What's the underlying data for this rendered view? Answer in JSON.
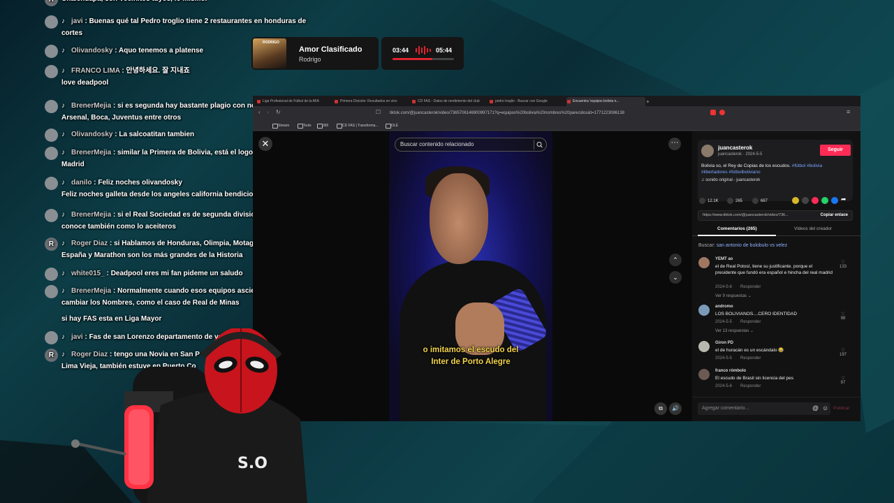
{
  "chat": [
    {
      "user": "",
      "text": "Chalchuapa, son Vecinitos tuyos, lo mismo.",
      "cont": "",
      "avatar": "R",
      "partial": true
    },
    {
      "user": "javi",
      "text": "Buenas qué tal Pedro troglio tiene 2 restaurantes en honduras de",
      "cont": "cortes"
    },
    {
      "user": "Olivandosky",
      "text": "Aquo tenemos a platense",
      "cont": ""
    },
    {
      "user": "FRANCO LIMA",
      "text": "안녕하세요. 잘 지내죠",
      "cont": "love deadpool"
    },
    {
      "user": "BrenerMejia",
      "text": "si es segunda hay bastante plagio con nombre está",
      "cont": "Arsenal, Boca, Juventus entre otros"
    },
    {
      "user": "Olivandosky",
      "text": "La salcoatitan tambien",
      "cont": ""
    },
    {
      "user": "BrenerMejia",
      "text": "similar la Primera de Bolivia, está el logo de River, Real",
      "cont": "Madrid"
    },
    {
      "user": "danilo",
      "text": "Feliz noches olivandosky",
      "cont": "Feliz noches galleta desde los angeles california bendiciones"
    },
    {
      "user": "BrenerMejia",
      "text": "si el Real Sociedad es de segunda división también, se le",
      "cont": "conoce también como lo aceiteros"
    },
    {
      "user": "Roger Diaz",
      "text": "si Hablamos de Honduras, Olimpia, Motagua, Real",
      "cont": "España y Marathon son los más grandes de la Historia",
      "avatar": "R"
    },
    {
      "user": "white015_",
      "text": "Deadpool eres mi fan pideme un saludo",
      "cont": ""
    },
    {
      "user": "BrenerMejia",
      "text": "Normalmente cuando esos equipos ascienden suelen",
      "cont": "cambiar los Nombres, como el caso de Real de Minas"
    },
    {
      "user": "",
      "text": "si hay FAS esta en Liga Mayor",
      "cont": ""
    },
    {
      "user": "javi",
      "text": "Fas de san Lorenzo departamento de vall",
      "cont": ""
    },
    {
      "user": "Roger Diaz",
      "text": "tengo una Novia en San P",
      "cont": "Lima Vieja, también estuve en Puerto Co",
      "avatar": "R",
      "tail": "ente en"
    }
  ],
  "music": {
    "title": "Amor Clasificado",
    "artist": "Rodrigo",
    "cover_text": "RODRIGO",
    "elapsed": "03:44",
    "total": "05:44",
    "progress": 0.65
  },
  "browser": {
    "tabs": [
      "Liga Profesional de Fútbol de la AFA",
      "Primera División: Resultados en vivo",
      "CD FAS - Datos de rendimiento del club",
      "pedro troglio - Buscar con Google",
      "Encuentra 'equipos bolivia n...",
      "+"
    ],
    "url": "tiktok.com/@juancasterok/video/7365706146900997171?q=equipos%20bolivia%20nombres%20parecidos&t=1771223086138",
    "bookmarks": [
      "Stream",
      "Tools",
      "365",
      "CD FAS | Transforma...",
      "OLÉ"
    ]
  },
  "tiktok": {
    "search_placeholder": "Buscar contenido relacionado",
    "caption_line1": "o imitamos el escudo del",
    "caption_line2": "Inter de Porto Alegre",
    "author_name": "juancasterok",
    "author_sub": "juancasterok · 2024-5-5",
    "follow": "Seguir",
    "desc_text": "Bolivia so, el Rey de Copias de los escudos. ",
    "desc_tags": "#fútbol #bolivia #libertadores #fútbolboliviano",
    "sound": "♫ sonido original - juancasterok",
    "likes": "12.1K",
    "comments": "265",
    "saves": "667",
    "link": "https://www.tiktok.com/@juancasterok/video/736...",
    "copy": "Copiar enlace",
    "tab_comments": "Comentarios (265)",
    "tab_videos": "Videos del creador",
    "buscar_label": "Buscar:",
    "buscar_query": "san antonio de bulobulo vs velez",
    "comments_list": [
      {
        "name": "YEMT ao",
        "text": "el de Real Potosí, tiene su justificante. porque el presidente que fundó era español e hincha del real madrid",
        "date": "2024-5-6",
        "reply": "Responder",
        "replies": "Ver 9 respuestas ⌄",
        "likes": "133"
      },
      {
        "name": "andromo",
        "text": "LOS BOLIVIANOS....CERO IDENTIDAD",
        "date": "2024-5-5",
        "reply": "Responder",
        "replies": "Ver 13 respuestas ⌄",
        "likes": "98"
      },
      {
        "name": "Giron PD",
        "text": "el de huracán es un escándalo 😂",
        "date": "2024-5-5",
        "reply": "Responder",
        "replies": "",
        "likes": "197"
      },
      {
        "name": "franco rómbolo",
        "text": "El escudo de Brasil sin licencia del pes",
        "date": "2024-5-6",
        "reply": "Responder",
        "replies": "",
        "likes": "97"
      }
    ],
    "add_comment": "Agregar comentario...",
    "publish": "Publicar"
  },
  "colors": {
    "accent": "#fe2c55",
    "caption": "#f3d24b",
    "link": "#7aa6ff"
  }
}
